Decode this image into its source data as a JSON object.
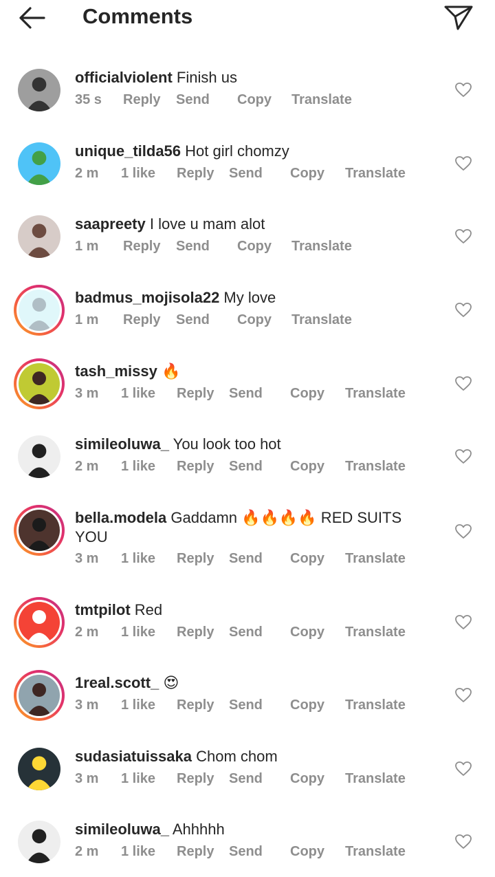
{
  "header": {
    "title": "Comments",
    "back_icon": "arrow-left-icon",
    "share_icon": "paper-plane-icon"
  },
  "comments": [
    {
      "username": "officialviolent",
      "text": "Finish us",
      "time": "35 s",
      "likes": "",
      "reply": "Reply",
      "send": "Send",
      "copy": "Copy",
      "translate": "Translate",
      "story": false
    },
    {
      "username": "unique_tilda56",
      "text": "Hot girl chomzy",
      "time": "2 m",
      "likes": "1 like",
      "reply": "Reply",
      "send": "Send",
      "copy": "Copy",
      "translate": "Translate",
      "story": false
    },
    {
      "username": "saapreety",
      "text": "I love u mam alot",
      "time": "1 m",
      "likes": "",
      "reply": "Reply",
      "send": "Send",
      "copy": "Copy",
      "translate": "Translate",
      "story": false
    },
    {
      "username": "badmus_mojisola22",
      "text": "My love",
      "time": "1 m",
      "likes": "",
      "reply": "Reply",
      "send": "Send",
      "copy": "Copy",
      "translate": "Translate",
      "story": true
    },
    {
      "username": "tash_missy",
      "text": "🔥",
      "time": "3 m",
      "likes": "1 like",
      "reply": "Reply",
      "send": "Send",
      "copy": "Copy",
      "translate": "Translate",
      "story": true
    },
    {
      "username": "simileoluwa_",
      "text": "You look too hot",
      "time": "2 m",
      "likes": "1 like",
      "reply": "Reply",
      "send": "Send",
      "copy": "Copy",
      "translate": "Translate",
      "story": false
    },
    {
      "username": "bella.modela",
      "text": "Gaddamn 🔥🔥🔥🔥 RED SUITS YOU",
      "time": "3 m",
      "likes": "1 like",
      "reply": "Reply",
      "send": "Send",
      "copy": "Copy",
      "translate": "Translate",
      "story": true
    },
    {
      "username": "tmtpilot",
      "text": "Red",
      "time": "2 m",
      "likes": "1 like",
      "reply": "Reply",
      "send": "Send",
      "copy": "Copy",
      "translate": "Translate",
      "story": true
    },
    {
      "username": "1real.scott_",
      "text": "😍",
      "time": "3 m",
      "likes": "1 like",
      "reply": "Reply",
      "send": "Send",
      "copy": "Copy",
      "translate": "Translate",
      "story": true
    },
    {
      "username": "sudasiatuissaka",
      "text": "Chom chom",
      "time": "3 m",
      "likes": "1 like",
      "reply": "Reply",
      "send": "Send",
      "copy": "Copy",
      "translate": "Translate",
      "story": false
    },
    {
      "username": "simileoluwa_",
      "text": "Ahhhhh",
      "time": "2 m",
      "likes": "1 like",
      "reply": "Reply",
      "send": "Send",
      "copy": "Copy",
      "translate": "Translate",
      "story": false
    }
  ],
  "colors": {
    "text": "#262626",
    "meta": "#8e8e8e",
    "story_ring": "#e1306c"
  }
}
